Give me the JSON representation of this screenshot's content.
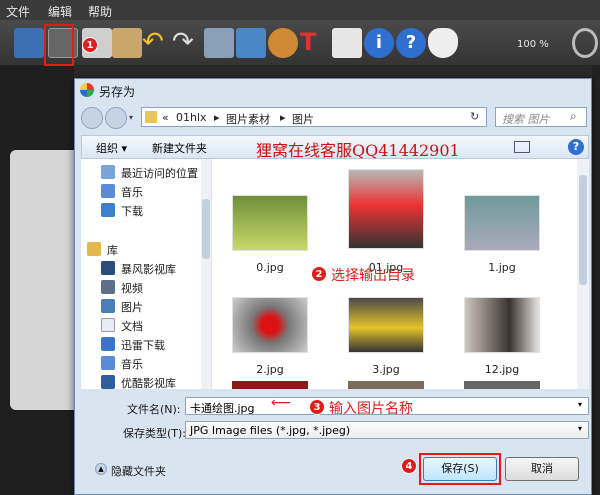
{
  "menu": {
    "file": "文件",
    "edit": "编辑",
    "help": "帮助"
  },
  "toolbar": {
    "zoom": "100 %"
  },
  "dialog": {
    "title": "另存为",
    "breadcrumb": [
      "«",
      "01hlx",
      "▸",
      "图片素材",
      "▸",
      "图片"
    ],
    "search_placeholder": "搜索 图片",
    "organize": "组织 ▾",
    "new_folder": "新建文件夹",
    "overlay_text": "狸窝在线客服QQ41442901",
    "nav": [
      {
        "label": "最近访问的位置",
        "icon": "recent-places-icon"
      },
      {
        "label": "音乐",
        "icon": "music-icon"
      },
      {
        "label": "下载",
        "icon": "download-folder-icon"
      },
      {
        "label": "库",
        "icon": "library-icon"
      },
      {
        "label": "暴风影视库",
        "icon": "video-library-icon"
      },
      {
        "label": "视频",
        "icon": "video-icon"
      },
      {
        "label": "图片",
        "icon": "pictures-icon"
      },
      {
        "label": "文档",
        "icon": "documents-icon"
      },
      {
        "label": "迅雷下载",
        "icon": "thunder-download-icon"
      },
      {
        "label": "音乐",
        "icon": "music-icon"
      },
      {
        "label": "优酷影视库",
        "icon": "youku-library-icon"
      }
    ],
    "files": [
      "0.jpg",
      "01.jpg",
      "1.jpg",
      "2.jpg",
      "3.jpg",
      "12.jpg"
    ],
    "filename_label": "文件名(N):",
    "filename_value": "卡通绘图.jpg",
    "filetype_label": "保存类型(T):",
    "filetype_value": "JPG Image files (*.jpg, *.jpeg)",
    "hide_folders": "隐藏文件夹",
    "save": "保存(S)",
    "cancel": "取消"
  },
  "annotations": {
    "n1": "1",
    "n2": "2",
    "n3": "3",
    "n4": "4",
    "step2": "选择输出目录",
    "step3": "输入图片名称"
  }
}
